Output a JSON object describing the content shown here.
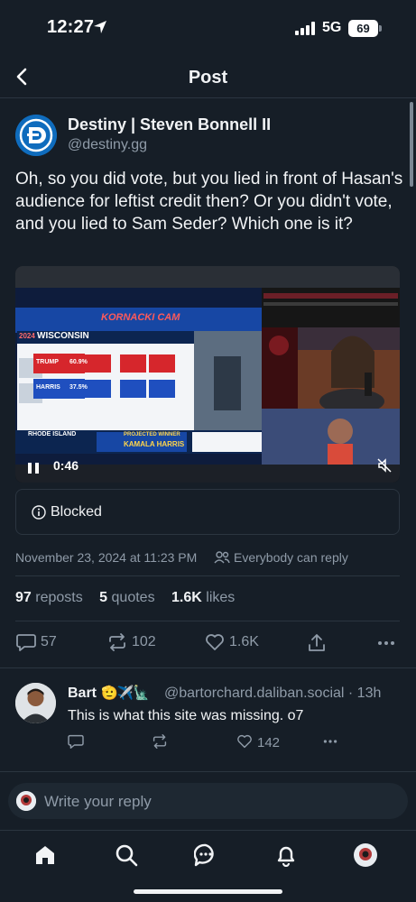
{
  "status_bar": {
    "time": "12:27",
    "network": "5G",
    "battery": "69"
  },
  "header": {
    "title": "Post",
    "back_icon": "chevron-left-icon"
  },
  "post": {
    "author_name": "Destiny | Steven Bonnell II",
    "author_handle": "@destiny.gg",
    "text": "Oh, so you did vote, but you lied in front of Hasan's audience for leftist credit then? Or you didn't vote, and you lied to Sam Seder? Which one is it?",
    "video": {
      "time": "0:46",
      "broadcast_banner": "KORNACKI CAM",
      "state_title": "WISCONSIN",
      "year": "2024",
      "candidates": [
        {
          "name": "TRUMP",
          "pct": "60.9%"
        },
        {
          "name": "HARRIS",
          "pct": "37.5%"
        }
      ],
      "lower_state": "RHODE ISLAND",
      "projected_label": "PROJECTED WINNER",
      "projected_name": "KAMALA HARRIS"
    },
    "blocked_label": "Blocked",
    "date": "November 23, 2024 at 11:23 PM",
    "reply_permission": "Everybody can reply",
    "stats": {
      "reposts": "97",
      "reposts_label": "reposts",
      "quotes": "5",
      "quotes_label": "quotes",
      "likes": "1.6K",
      "likes_label": "likes"
    },
    "actions": {
      "replies": "57",
      "reposts": "102",
      "likes": "1.6K"
    }
  },
  "reply": {
    "name": "Bart",
    "emojis": "🫡✈️🗽",
    "handle": "@bartorchard.daliban.social · 13h",
    "text": "This is what this site was missing. o7",
    "likes": "142"
  },
  "composer": {
    "placeholder": "Write your reply"
  },
  "colors": {
    "background": "#161e27",
    "accent": "#0f6cbd",
    "muted": "#8f9ba8"
  }
}
